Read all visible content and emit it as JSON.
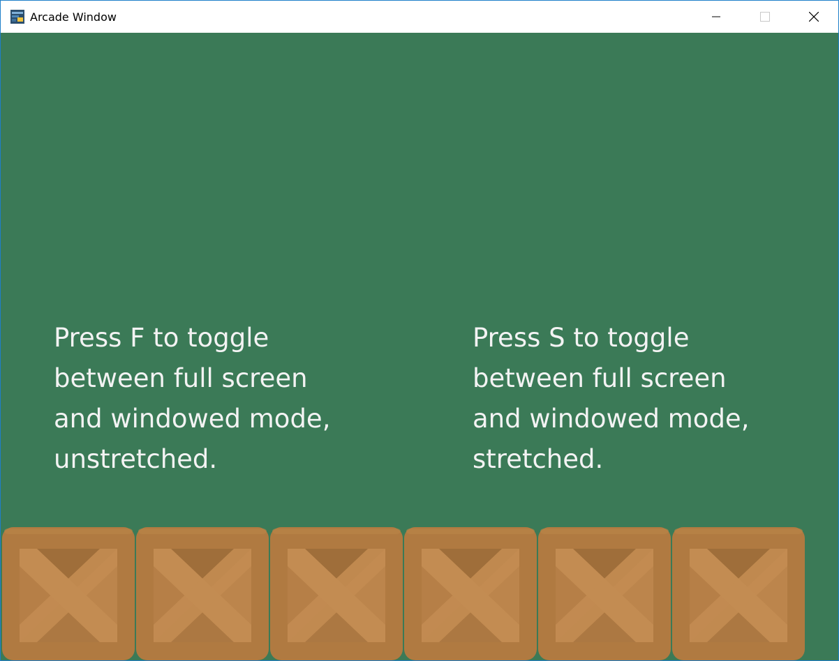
{
  "window": {
    "title": "Arcade Window",
    "icon": "python-arcade-icon",
    "controls": {
      "minimize": "minimize-icon",
      "maximize": "maximize-icon",
      "close": "close-icon"
    }
  },
  "canvas": {
    "background_color": "#3b7a57"
  },
  "instructions": {
    "left": "Press F to toggle\nbetween full screen\nand windowed mode,\nunstretched.",
    "right": "Press S to toggle\nbetween full screen\nand windowed mode,\nstretched."
  },
  "crates": {
    "sprite": "wooden-crate",
    "count": 6,
    "colors": {
      "frame": "#b07a41",
      "panel": "#bc854c",
      "shadow": "#9f6e3a",
      "plank": "#c38c52"
    }
  }
}
